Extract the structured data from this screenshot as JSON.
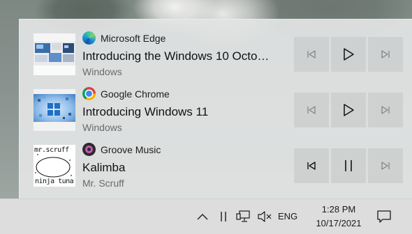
{
  "media_sessions": [
    {
      "app_name": "Microsoft Edge",
      "app_icon": "edge-icon",
      "title": "Introducing the Windows 10 Octo…",
      "subtitle": "Windows",
      "state": "paused",
      "prev_enabled": false,
      "next_enabled": false
    },
    {
      "app_name": "Google Chrome",
      "app_icon": "chrome-icon",
      "title": "Introducing Windows 11",
      "subtitle": "Windows",
      "state": "paused",
      "prev_enabled": false,
      "next_enabled": false
    },
    {
      "app_name": "Groove Music",
      "app_icon": "groove-music-icon",
      "title": "Kalimba",
      "subtitle": "Mr. Scruff",
      "state": "playing",
      "prev_enabled": true,
      "next_enabled": false,
      "album_art_text": [
        "mr.scruff",
        "ninja tuna"
      ]
    }
  ],
  "taskbar": {
    "language": "ENG",
    "time": "1:28 PM",
    "date": "10/17/2021",
    "tray_icons": [
      "chevron-up-icon",
      "media-pause-icon",
      "network-icon",
      "volume-muted-icon"
    ],
    "notification_icon": "action-center-icon"
  }
}
